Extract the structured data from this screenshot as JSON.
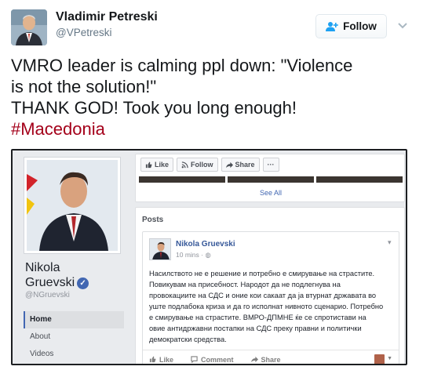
{
  "tweet": {
    "author_name": "Vladimir Petreski",
    "author_handle": "@VPetreski",
    "follow_label": "Follow",
    "text_lines": [
      "VMRO leader is calming ppl down: \"Violence",
      "is not the solution!\"",
      "THANK GOD! Took you long enough!"
    ],
    "hashtag": "#Macedonia"
  },
  "facebook": {
    "page_name_line1": "Nikola",
    "page_name_line2": "Gruevski",
    "verified_mark": "✓",
    "page_handle": "@NGruevski",
    "nav": [
      "Home",
      "About",
      "Videos"
    ],
    "top_actions": [
      "Like",
      "Follow",
      "Share",
      "···"
    ],
    "see_all": "See All",
    "posts_title": "Posts",
    "post": {
      "author": "Nikola Gruevski",
      "time": "10 mins · ",
      "text_lines": [
        "Насилството не е решение и потребно е смирување на страстите.",
        "Повикувам на присебност. Народот да не подлегнува на",
        "провокациите на СДС и оние кои сакаат да ја втурнат државата во",
        "уште подлабока криза и да го исполнат нивното сценарио. Потребно",
        "е смирување на страстите. ВМРО-ДПМНЕ ќе се спротистави на",
        "овие антидржавни постапки на СДС преку правни и политички",
        "демократски средства."
      ],
      "actions": [
        "Like",
        "Comment",
        "Share"
      ]
    }
  },
  "colors": {
    "hashtag": "#a4001a",
    "fb_blue": "#4267b2",
    "fb_link": "#365899"
  }
}
